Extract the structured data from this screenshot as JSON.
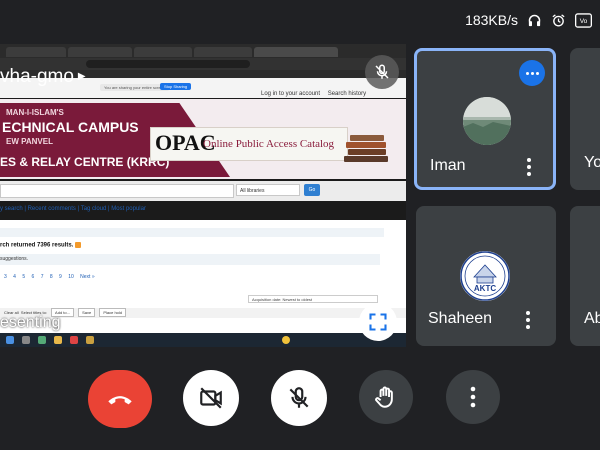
{
  "status": {
    "speed": "183KB/s"
  },
  "shared_screen": {
    "presenter_name": "vha-gmo",
    "presenting_label": "esenting",
    "share_notice": "You are sharing your entire screen",
    "stop_sharing": "Stop Sharing",
    "login_link": "Log in to your account",
    "history_link": "Search history",
    "banner": {
      "line1": "MAN-I-ISLAM'S",
      "line2": "ECHNICAL CAMPUS",
      "line3": "EW PANVEL",
      "line4": "ES & RELAY CENTRE (KRRC)",
      "opac_title": "OPAC",
      "opac_subtitle": "Online Public Access Catalog"
    },
    "library_select": "All libraries",
    "go_button": "Go",
    "nav_links": "y search | Recent comments | Tag cloud | Most popular",
    "results_text": "rch returned 7396 results.",
    "suggestions": "suggestions.",
    "pages": [
      "3",
      "4",
      "5",
      "6",
      "7",
      "8",
      "9",
      "10",
      "Next »"
    ],
    "sort_label": "Acquisition date: Newest to oldest",
    "list_toolbar": {
      "clear_all": "Clear all",
      "select_titles": "Select titles to:",
      "add_to": "Add to...",
      "save": "Save",
      "place_hold": "Place hold"
    }
  },
  "participants": [
    {
      "name": "Iman"
    },
    {
      "name": "Shaheen"
    },
    {
      "name": "Yo"
    },
    {
      "name": "Ab"
    }
  ],
  "colors": {
    "accent": "#8ab4f8",
    "end_call": "#ea4335",
    "tile": "#3c4043",
    "background": "#202124"
  },
  "controls": [
    "end-call",
    "camera-off",
    "mic-off",
    "raise-hand",
    "more-options"
  ]
}
